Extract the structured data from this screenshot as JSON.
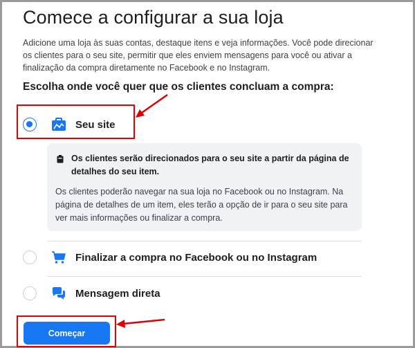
{
  "header": {
    "title": "Comece a configurar a sua loja",
    "description": "Adicione uma loja às suas contas, destaque itens e veja informações. Você pode direcionar os clientes para o seu site, permitir que eles enviem mensagens para você ou ativar a finalização da compra diretamente no Facebook e no Instagram."
  },
  "checkout": {
    "prompt": "Escolha onde você quer que os clientes concluam a compra:",
    "options": [
      {
        "label": "Seu site",
        "icon": "briefcase-icon",
        "selected": true
      },
      {
        "label": "Finalizar a compra no Facebook ou no Instagram",
        "icon": "cart-icon",
        "selected": false
      },
      {
        "label": "Mensagem direta",
        "icon": "chat-bubbles-icon",
        "selected": false
      }
    ],
    "info": {
      "icon": "external-link-icon",
      "bold": "Os clientes serão direcionados para o seu site a partir da página de detalhes do seu item.",
      "text": "Os clientes poderão navegar na sua loja no Facebook ou no Instagram. Na página de detalhes de um item, eles terão a opção de ir para o seu site para ver mais informações ou finalizar a compra."
    }
  },
  "actions": {
    "start_label": "Começar"
  },
  "colors": {
    "accent": "#1877f2",
    "annotation": "#e00000"
  }
}
